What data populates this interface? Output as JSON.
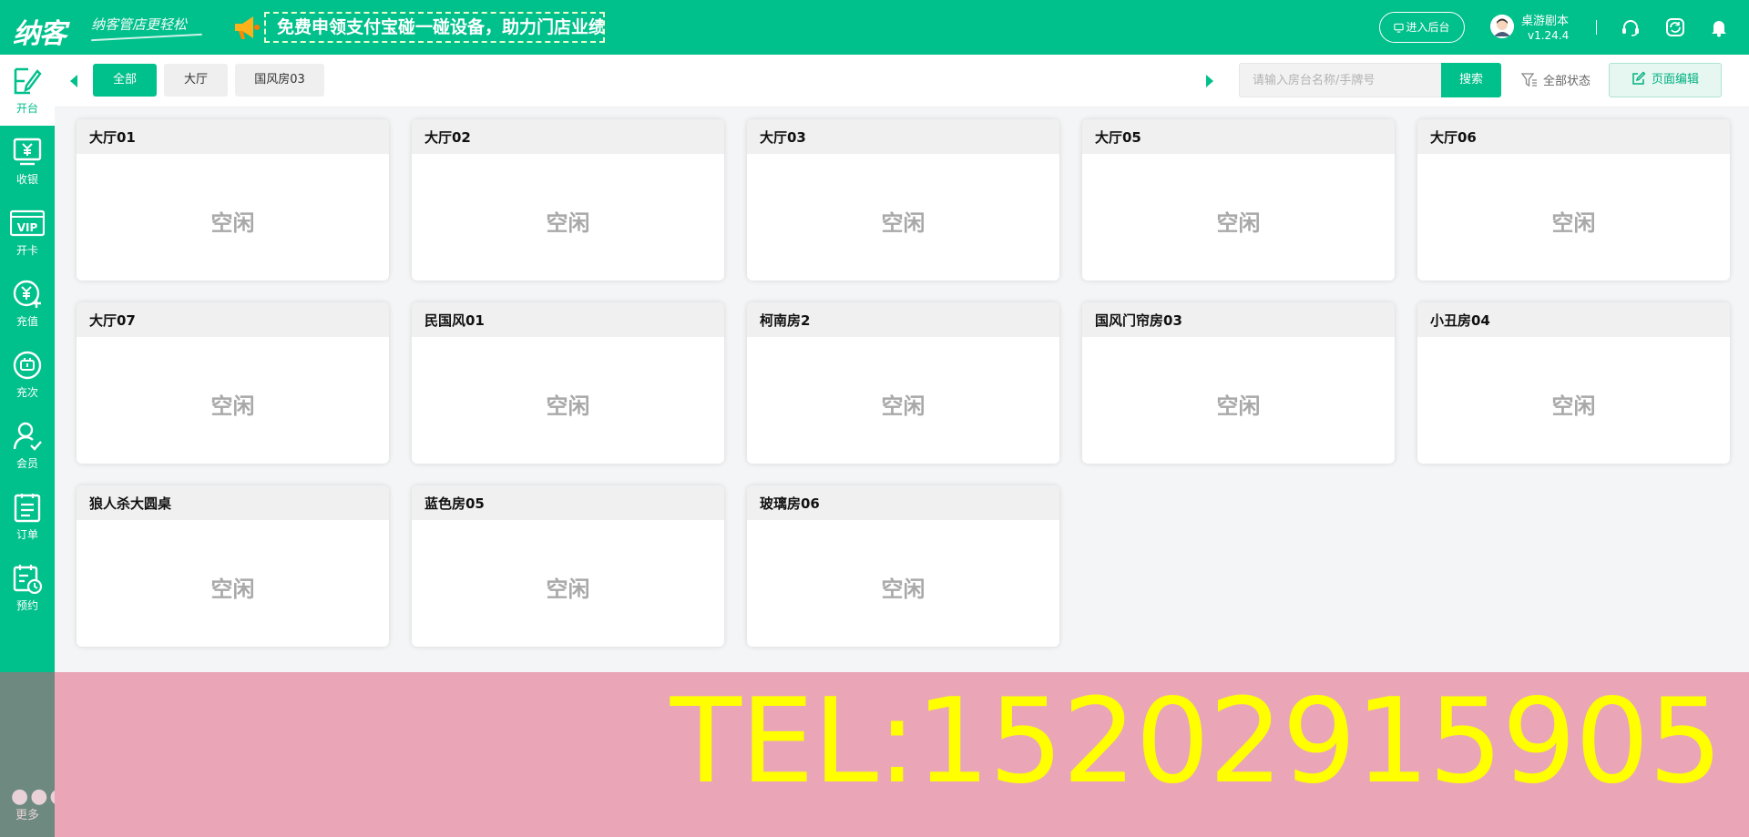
{
  "header": {
    "logo": "纳客",
    "slogan": "纳客管店更轻松",
    "banner": "免费申领支付宝碰一碰设备，助力门店业绩倍增！",
    "enter_backend": "进入后台",
    "user_name": "桌游剧本",
    "version": "v1.24.4",
    "icons": [
      "headset-icon",
      "sync-icon",
      "bell-icon"
    ]
  },
  "sidebar": {
    "items": [
      {
        "label": "开台",
        "icon": "open-table-icon"
      },
      {
        "label": "收银",
        "icon": "cashier-icon"
      },
      {
        "label": "开卡",
        "icon": "vip-card-icon"
      },
      {
        "label": "充值",
        "icon": "recharge-icon"
      },
      {
        "label": "充次",
        "icon": "recharge-times-icon"
      },
      {
        "label": "会员",
        "icon": "member-icon"
      },
      {
        "label": "订单",
        "icon": "order-icon"
      },
      {
        "label": "预约",
        "icon": "reservation-icon"
      }
    ],
    "more": "更多"
  },
  "filters": {
    "tabs": [
      "全部",
      "大厅",
      "国风房03"
    ],
    "active_tab": 0,
    "search_placeholder": "请输入房台名称/手牌号",
    "search_button": "搜索",
    "status_filter": "全部状态",
    "edit_button": "页面编辑"
  },
  "rooms": [
    {
      "name": "大厅01",
      "status": "空闲"
    },
    {
      "name": "大厅02",
      "status": "空闲"
    },
    {
      "name": "大厅03",
      "status": "空闲"
    },
    {
      "name": "大厅05",
      "status": "空闲"
    },
    {
      "name": "大厅06",
      "status": "空闲"
    },
    {
      "name": "大厅07",
      "status": "空闲"
    },
    {
      "name": "民国风01",
      "status": "空闲"
    },
    {
      "name": "柯南房2",
      "status": "空闲"
    },
    {
      "name": "国风门帘房03",
      "status": "空闲"
    },
    {
      "name": "小丑房04",
      "status": "空闲"
    },
    {
      "name": "狼人杀大圆桌",
      "status": "空闲"
    },
    {
      "name": "蓝色房05",
      "status": "空闲"
    },
    {
      "name": "玻璃房06",
      "status": "空闲"
    }
  ],
  "promo": {
    "text": "TEL:15202915905"
  },
  "colors": {
    "brand": "#00c08b",
    "promo_bg": "#eaa6b6",
    "promo_text": "#ffff00",
    "status_text": "#a9a9a9"
  }
}
